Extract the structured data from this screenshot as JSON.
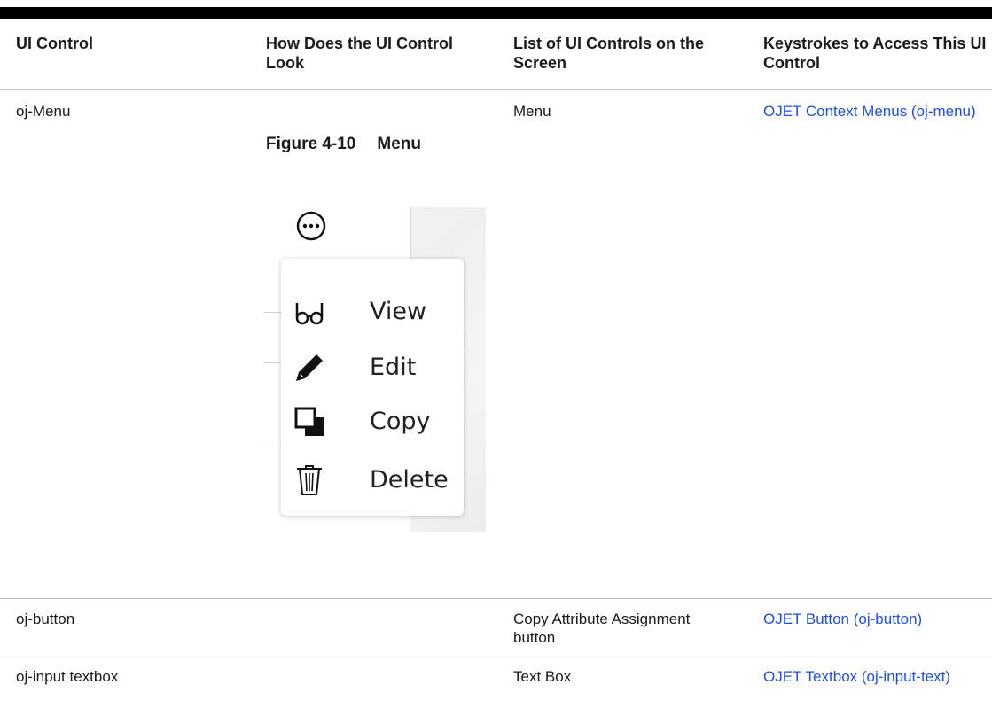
{
  "table": {
    "headers": [
      "UI Control",
      "How Does the UI Control Look",
      "List of UI Controls on the Screen",
      "Keystrokes to Access This UI Control"
    ],
    "rows": [
      {
        "control": "oj-Menu",
        "list": "Menu",
        "link": "OJET Context Menus (oj-menu)"
      },
      {
        "control": "oj-button",
        "list": "Copy Attribute Assignment button",
        "link": "OJET Button (oj-button)"
      },
      {
        "control": "oj-input textbox",
        "list": "Text Box",
        "link": "OJET Textbox (oj-input-text)"
      }
    ]
  },
  "figure": {
    "number": "Figure 4-10",
    "title": "Menu",
    "menu_items": [
      {
        "label": "View",
        "icon": "glasses-icon"
      },
      {
        "label": "Edit",
        "icon": "pencil-icon"
      },
      {
        "label": "Copy",
        "icon": "copy-icon"
      },
      {
        "label": "Delete",
        "icon": "trash-icon"
      }
    ],
    "trigger_icon": "more-horizontal-icon"
  }
}
